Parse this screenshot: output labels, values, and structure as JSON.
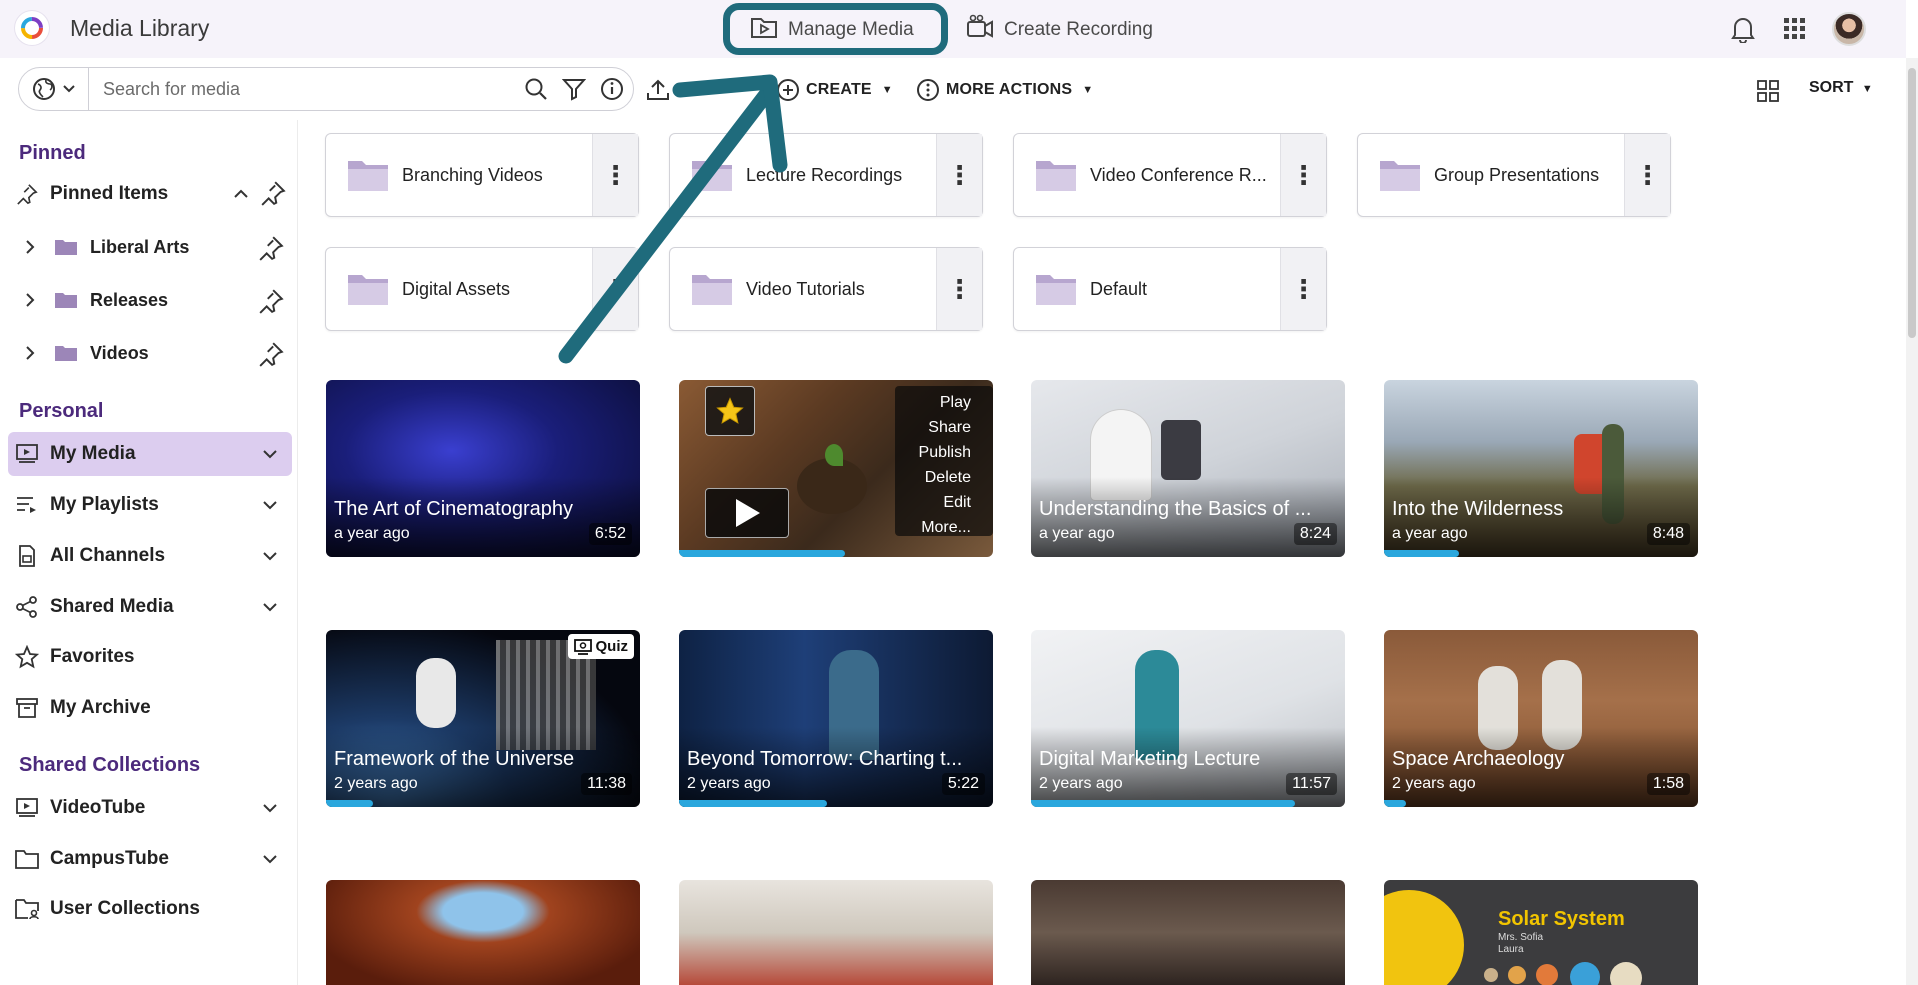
{
  "app": {
    "title": "Media Library"
  },
  "topnav": {
    "manage_media": "Manage Media",
    "create_recording": "Create Recording"
  },
  "toolbar": {
    "search_placeholder": "Search for media",
    "upload_label": "U",
    "create_label": "CREATE",
    "more_actions_label": "MORE ACTIONS",
    "sort_label": "SORT"
  },
  "sidebar": {
    "pinned_title": "Pinned",
    "pinned_items": "Pinned Items",
    "pinned_children": [
      "Liberal Arts",
      "Releases",
      "Videos"
    ],
    "personal_title": "Personal",
    "personal_items": [
      "My Media",
      "My Playlists",
      "All Channels",
      "Shared Media",
      "Favorites",
      "My Archive"
    ],
    "shared_collections_title": "Shared Collections",
    "shared_collections_items": [
      "VideoTube",
      "CampusTube",
      "User Collections"
    ]
  },
  "folders": [
    "Branching Videos",
    "Lecture Recordings",
    "Video Conference R...",
    "Group Presentations",
    "Digital Assets",
    "Video Tutorials",
    "Default"
  ],
  "media": [
    {
      "title": "The Art of Cinematography",
      "date": "a year ago",
      "duration": "6:52",
      "progress": 0
    },
    {
      "title": "",
      "date": "",
      "duration": "",
      "progress": 0.53
    },
    {
      "title": "Understanding the Basics of ...",
      "date": "a year ago",
      "duration": "8:24",
      "progress": 0
    },
    {
      "title": "Into the Wilderness",
      "date": "a year ago",
      "duration": "8:48",
      "progress": 0.24
    },
    {
      "title": "Framework of the Universe",
      "date": "2 years ago",
      "duration": "11:38",
      "progress": 0.15
    },
    {
      "title": "Beyond Tomorrow: Charting t...",
      "date": "2 years ago",
      "duration": "5:22",
      "progress": 0.47
    },
    {
      "title": "Digital Marketing Lecture",
      "date": "2 years ago",
      "duration": "11:57",
      "progress": 0.84
    },
    {
      "title": "Space Archaeology",
      "date": "2 years ago",
      "duration": "1:58",
      "progress": 0.07
    }
  ],
  "hover_menu": [
    "Play",
    "Share",
    "Publish",
    "Delete",
    "Edit",
    "More..."
  ],
  "quiz_badge": "Quiz",
  "solar": {
    "title": "Solar System",
    "teacher": "Mrs. Sofia",
    "name": "Laura"
  },
  "colors": {
    "accent": "#4c2a7c",
    "active_bg": "#dccdef",
    "progress": "#2aa7dd",
    "annotation": "#1f6b7c"
  }
}
